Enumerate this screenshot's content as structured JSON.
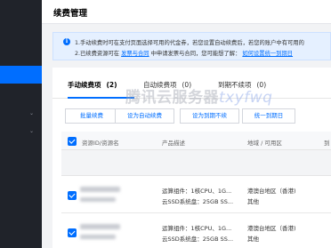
{
  "header": {
    "title": "续费管理"
  },
  "notice": {
    "line1": "1.手动续费时可在支付页面选择可用的代金券，若您设置自动续费后，若您的账户中有可用的",
    "line2_prefix": "2.已续费资源可在",
    "line2_link1": "发票与合同",
    "line2_middle": "中申请发票与合同，您可能想了解：",
    "line2_link2": "如何设置统一到期日"
  },
  "tabs": [
    {
      "label": "手动续费项",
      "count": "(2)"
    },
    {
      "label": "自动续费项",
      "count": "(0)"
    },
    {
      "label": "到期不续项",
      "count": "(0)"
    }
  ],
  "toolbar": {
    "batch_renew": "批量续费",
    "set_auto": "设为自动续费",
    "set_no_renew": "设为到期不续",
    "unify_date": "统一到期日"
  },
  "table": {
    "columns": [
      "资源ID/资源名",
      "产品描述",
      "地域 / 可用区",
      "到"
    ],
    "rows": [
      {
        "desc1": "运算组件：1核CPU、1G...",
        "desc2": "云SSD系统盘：25GB SS...",
        "region1": "港澳台地区（香港)",
        "region2": "其他"
      },
      {
        "desc1": "运算组件：1核CPU、1G...",
        "desc2": "云SSD系统盘：25GB SS...",
        "region1": "港澳台地区（香港)",
        "region2": "其他"
      }
    ]
  },
  "watermark": {
    "cn": "腾讯云服务器",
    "latin": "txyfwq"
  },
  "colors": {
    "primary": "#006eff",
    "sidebar": "#20232a",
    "notice_bg": "#e5f0ff"
  }
}
